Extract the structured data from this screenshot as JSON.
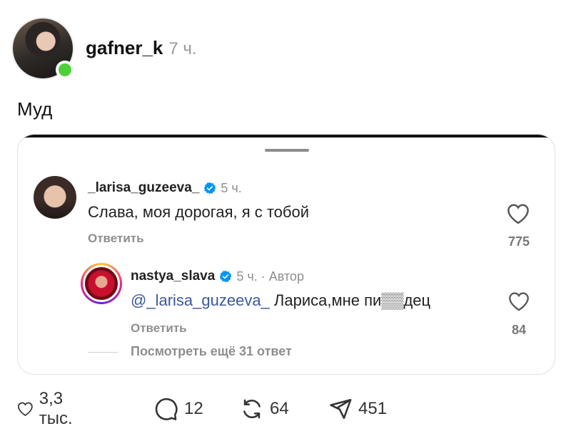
{
  "post": {
    "username": "gafner_k",
    "time": "7 ч.",
    "caption": "Муд"
  },
  "comment_card": {
    "comments": [
      {
        "username": "_larisa_guzeeva_",
        "time": "5 ч.",
        "text": "Слава, моя дорогая, я с тобой",
        "reply_label": "Ответить",
        "likes": "775"
      }
    ],
    "reply": {
      "username": "nastya_slava",
      "time": "5 ч. · Автор",
      "mention": "@_larisa_guzeeva_",
      "text": " Лариса,мне пи▒▒дец",
      "reply_label": "Ответить",
      "likes": "84"
    },
    "more_replies": "Посмотреть ещё 31 ответ"
  },
  "actions": {
    "likes": "3,3 тыс.",
    "comments": "12",
    "reposts": "64",
    "shares": "451"
  },
  "colors": {
    "online": "#4cd137",
    "verified": "#0095f6",
    "mention": "#3b5998"
  }
}
